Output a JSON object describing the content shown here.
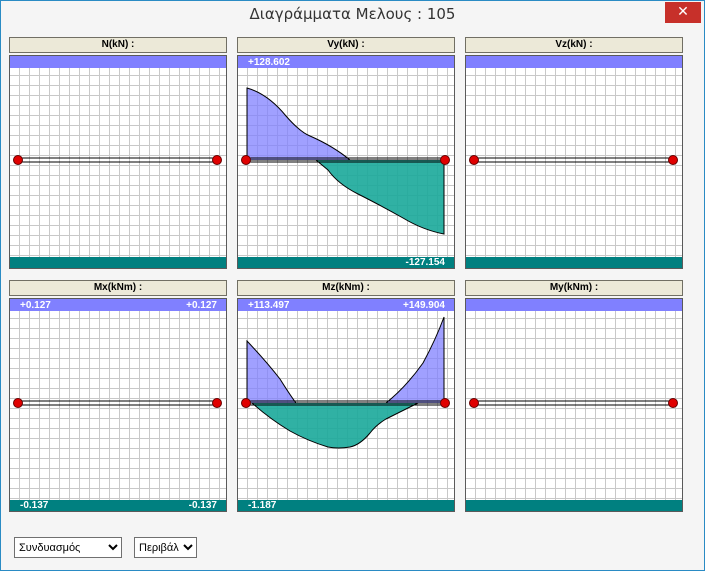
{
  "window": {
    "title": "Διαγράμματα Μελους  : 105",
    "close_glyph": "✕"
  },
  "panels": [
    {
      "title": "N(kN) :",
      "top_left": "",
      "top_right": "",
      "bottom_left": "",
      "bottom_right": ""
    },
    {
      "title": "Vy(kN) :",
      "top_left": "+128.602",
      "top_right": "",
      "bottom_left": "",
      "bottom_right": "-127.154"
    },
    {
      "title": "Vz(kN) :",
      "top_left": "",
      "top_right": "",
      "bottom_left": "",
      "bottom_right": ""
    },
    {
      "title": "Mx(kNm) :",
      "top_left": "+0.127",
      "top_right": "+0.127",
      "bottom_left": "-0.137",
      "bottom_right": "-0.137"
    },
    {
      "title": "Mz(kNm) :",
      "top_left": "+113.497",
      "top_right": "+149.904",
      "bottom_left": "-1.187",
      "bottom_right": ""
    },
    {
      "title": "My(kNm) :",
      "top_left": "",
      "top_right": "",
      "bottom_left": "",
      "bottom_right": ""
    }
  ],
  "controls": {
    "combination_select": "Συνδυασμός",
    "envelope_select": "Περιβάλ"
  },
  "colors": {
    "positive_fill": "#8080ff",
    "negative_fill": "#1aa89a",
    "support_dot": "#e00000",
    "close_button": "#c7302a"
  }
}
